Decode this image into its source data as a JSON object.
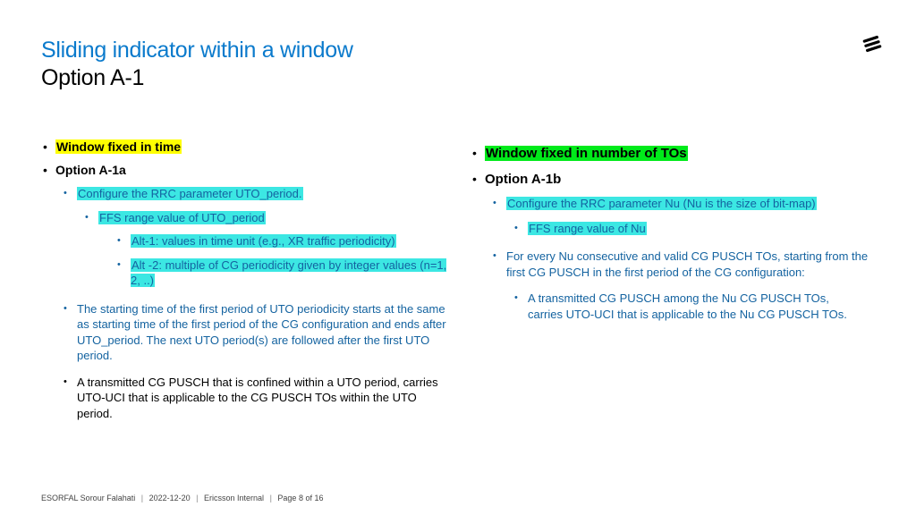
{
  "title": "Sliding indicator within a window",
  "subtitle": "Option A-1",
  "left": {
    "heading": "Window fixed in time",
    "option": "Option A-1a",
    "configure": "Configure the RRC parameter UTO_period.",
    "ffs": "FFS range value of UTO_period",
    "alt1": "Alt-1: values in time unit (e.g., XR traffic periodicity)",
    "alt2": "Alt -2: multiple of CG periodicity given by integer values (n=1, 2, ..)",
    "starting": "The starting time of the first period of UTO periodicity starts at the same as starting time of the first period of the CG configuration and ends after UTO_period. The next UTO period(s) are followed after the first UTO period.",
    "transmitted": "A transmitted CG PUSCH that is confined within a UTO period, carries UTO-UCI that is applicable to the CG PUSCH TOs within the UTO period."
  },
  "right": {
    "heading": "Window fixed in number of TOs",
    "option": "Option A-1b",
    "configure": "Configure the RRC parameter Nu (Nu is the size of bit-map)",
    "ffs": "FFS range value of Nu",
    "forEvery": "For every Nu consecutive and valid CG PUSCH TOs, starting from the first CG PUSCH in the first period of the CG configuration:",
    "transmitted": "A transmitted CG PUSCH among the Nu CG PUSCH TOs, carries UTO-UCI that is applicable to the Nu CG PUSCH TOs."
  },
  "footer": {
    "author": "ESORFAL Sorour Falahati",
    "date": "2022-12-20",
    "classification": "Ericsson Internal",
    "page": "Page 8 of 16"
  }
}
